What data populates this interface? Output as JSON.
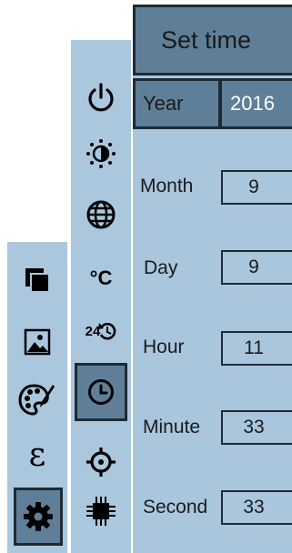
{
  "window": {
    "title": "Set time"
  },
  "sidebar_left": {
    "items": [
      {
        "icon": "layers-icon"
      },
      {
        "icon": "image-icon"
      },
      {
        "icon": "palette-icon"
      },
      {
        "icon": "epsilon-icon",
        "glyph": "ε"
      },
      {
        "icon": "gear-icon",
        "selected": true
      }
    ]
  },
  "sidebar_right": {
    "items": [
      {
        "icon": "power-icon"
      },
      {
        "icon": "brightness-icon"
      },
      {
        "icon": "globe-icon"
      },
      {
        "icon": "temperature-unit-icon",
        "label": "°C"
      },
      {
        "icon": "24h-format-icon",
        "label": "24"
      },
      {
        "icon": "clock-icon",
        "selected": true
      },
      {
        "icon": "crosshair-icon"
      },
      {
        "icon": "chip-icon"
      }
    ]
  },
  "form": {
    "year": {
      "label": "Year",
      "value": "2016"
    },
    "month": {
      "label": "Month",
      "value": "9"
    },
    "day": {
      "label": "Day",
      "value": "9"
    },
    "hour": {
      "label": "Hour",
      "value": "11"
    },
    "minute": {
      "label": "Minute",
      "value": "33"
    },
    "second": {
      "label": "Second",
      "value": "33"
    }
  },
  "colors": {
    "panel": "#aac7de",
    "selected": "#5f7f99",
    "border": "#1e2a33"
  }
}
